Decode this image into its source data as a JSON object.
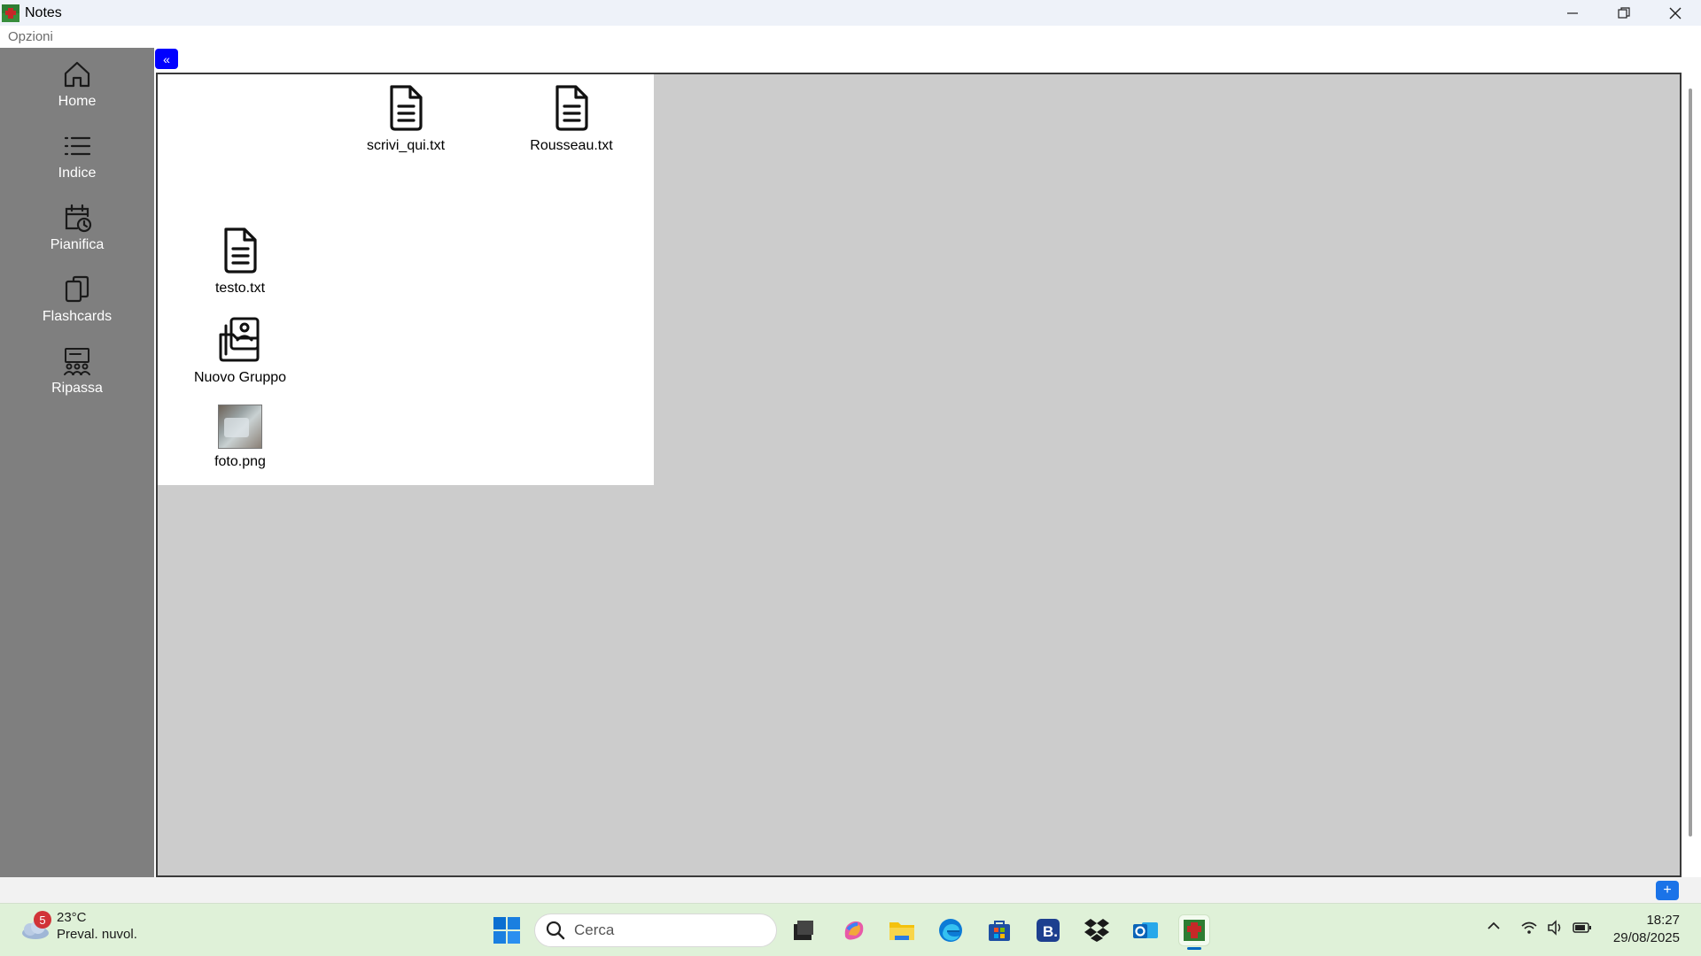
{
  "window": {
    "title": "Notes"
  },
  "menu": {
    "options_label": "Opzioni"
  },
  "sidebar": {
    "items": [
      {
        "label": "Home",
        "icon": "home-icon"
      },
      {
        "label": "Indice",
        "icon": "list-icon"
      },
      {
        "label": "Pianifica",
        "icon": "calendar-clock-icon"
      },
      {
        "label": "Flashcards",
        "icon": "cards-icon"
      },
      {
        "label": "Ripassa",
        "icon": "teacher-icon"
      }
    ]
  },
  "main": {
    "collapse_label": "«",
    "add_label": "+",
    "files": [
      {
        "name": "scrivi_qui.txt",
        "type": "text-file"
      },
      {
        "name": "Rousseau.txt",
        "type": "text-file"
      },
      {
        "name": "testo.txt",
        "type": "text-file"
      },
      {
        "name": "Nuovo Gruppo",
        "type": "group-folder"
      },
      {
        "name": "foto.png",
        "type": "image-file"
      }
    ]
  },
  "taskbar": {
    "weather": {
      "badge": "5",
      "temperature": "23°C",
      "condition": "Preval. nuvol."
    },
    "search_placeholder": "Cerca",
    "time": "18:27",
    "date": "29/08/2025"
  },
  "colors": {
    "sidebar_bg": "#7f7f7f",
    "canvas_bg": "#cccccc",
    "accent_blue": "#0000ff",
    "taskbar_bg": "#dff1d8"
  }
}
